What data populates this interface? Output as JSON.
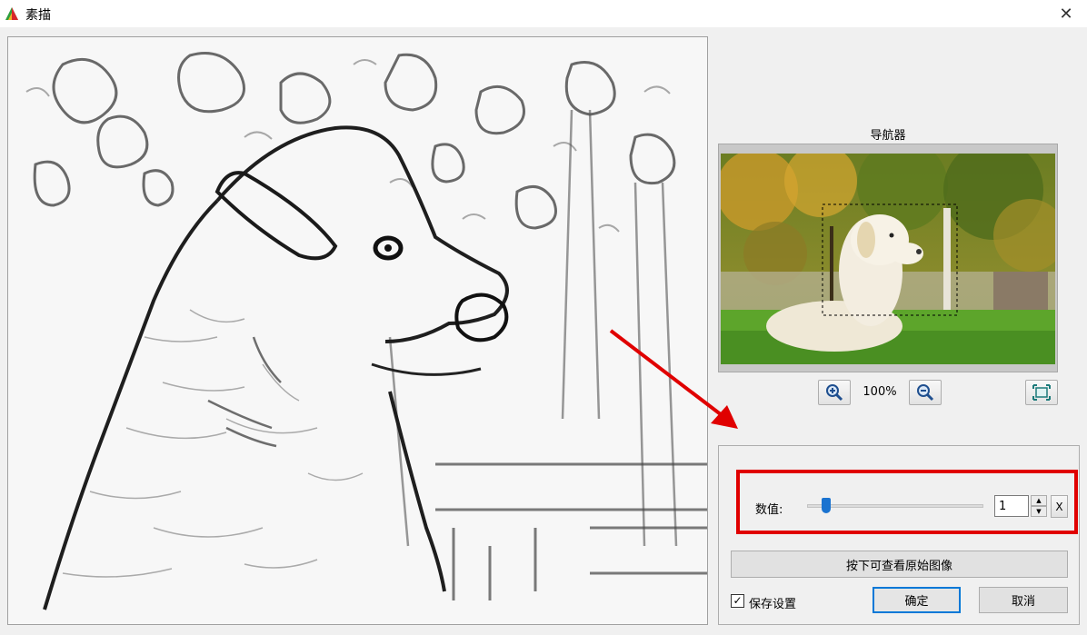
{
  "window": {
    "title": "素描",
    "close_glyph": "✕"
  },
  "navigator": {
    "label": "导航器",
    "zoom_level": "100%"
  },
  "settings": {
    "value_label": "数值:",
    "value": "1",
    "slider_fraction": 0.11,
    "reset_label": "X",
    "press_button_label": "按下可查看原始图像",
    "save_settings_label": "保存设置",
    "save_settings_checked": true,
    "ok_label": "确定",
    "cancel_label": "取消"
  },
  "icons": {
    "zoom_in": "zoom-in-icon",
    "zoom_out": "zoom-out-icon",
    "fit": "fit-to-window-icon",
    "spin_up": "▲",
    "spin_down": "▼",
    "checkmark": "✓"
  },
  "colors": {
    "annotation_red": "#e00000",
    "accent_blue": "#0078d7",
    "slider_blue": "#1a73d0"
  }
}
